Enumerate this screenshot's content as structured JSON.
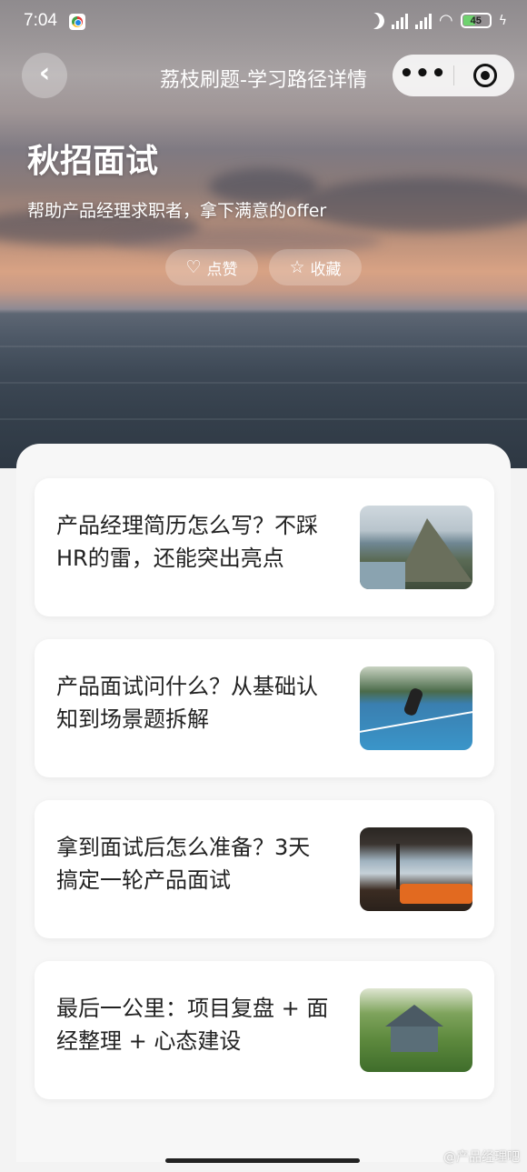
{
  "status_bar": {
    "time": "7:04",
    "battery": "45"
  },
  "nav": {
    "back_icon": "chevron-left-icon",
    "title": "荔枝刷题-学习路径详情",
    "more_icon": "more-dots-icon",
    "close_icon": "target-close-icon"
  },
  "hero": {
    "title": "秋招面试",
    "subtitle": "帮助产品经理求职者，拿下满意的offer",
    "like_label": "点赞",
    "like_icon": "heart-icon",
    "favorite_label": "收藏",
    "favorite_icon": "star-icon"
  },
  "cards": [
    {
      "title": "产品经理简历怎么写？不踩HR的雷，还能突出亮点",
      "thumb": "mountain-image"
    },
    {
      "title": "产品面试问什么？从基础认知到场景题拆解",
      "thumb": "tennis-court-image"
    },
    {
      "title": "拿到面试后怎么准备？3天搞定一轮产品面试",
      "thumb": "room-interior-image"
    },
    {
      "title": "最后一公里：项目复盘 + 面经整理 + 心态建设",
      "thumb": "house-image"
    }
  ],
  "watermark": "@产品经理吧"
}
